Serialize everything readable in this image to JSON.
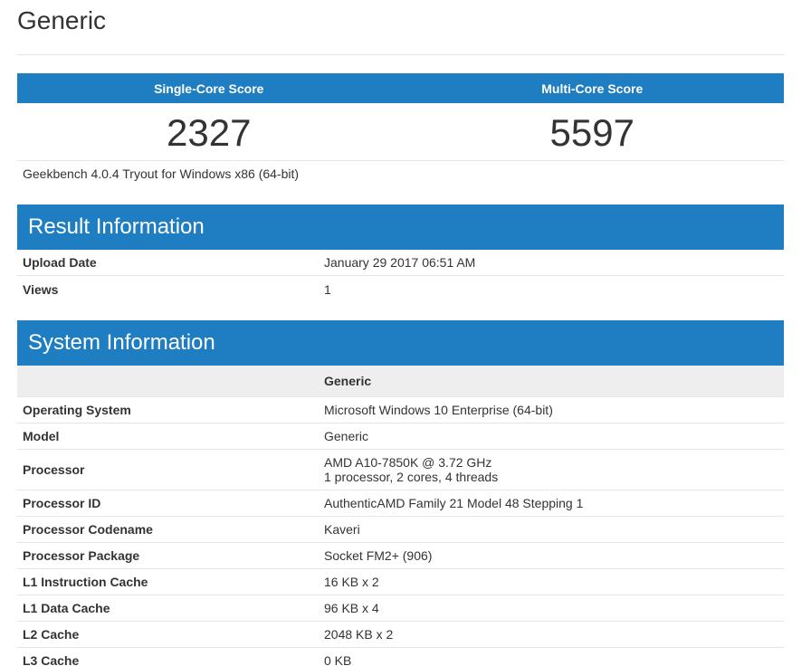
{
  "page": {
    "title": "Generic"
  },
  "scores": {
    "single_label": "Single-Core Score",
    "multi_label": "Multi-Core Score",
    "single_value": "2327",
    "multi_value": "5597"
  },
  "version": "Geekbench 4.0.4 Tryout for Windows x86 (64-bit)",
  "result_info": {
    "heading": "Result Information",
    "rows": [
      {
        "key": "Upload Date",
        "value": "January 29 2017 06:51 AM"
      },
      {
        "key": "Views",
        "value": "1"
      }
    ]
  },
  "system_info": {
    "heading": "System Information",
    "column_header": "Generic",
    "rows": [
      {
        "key": "Operating System",
        "value": "Microsoft Windows 10 Enterprise (64-bit)"
      },
      {
        "key": "Model",
        "value": "Generic"
      },
      {
        "key": "Processor",
        "value": "AMD A10-7850K @ 3.72 GHz",
        "value2": "1 processor, 2 cores, 4 threads"
      },
      {
        "key": "Processor ID",
        "value": "AuthenticAMD Family 21 Model 48 Stepping 1"
      },
      {
        "key": "Processor Codename",
        "value": "Kaveri"
      },
      {
        "key": "Processor Package",
        "value": "Socket FM2+ (906)"
      },
      {
        "key": "L1 Instruction Cache",
        "value": "16 KB x 2"
      },
      {
        "key": "L1 Data Cache",
        "value": "96 KB x 4"
      },
      {
        "key": "L2 Cache",
        "value": "2048 KB x 2"
      },
      {
        "key": "L3 Cache",
        "value": "0 KB"
      }
    ]
  },
  "colors": {
    "accent": "#1f7ec2",
    "header_bg": "#eeeeee",
    "border": "#e6e6e6"
  }
}
